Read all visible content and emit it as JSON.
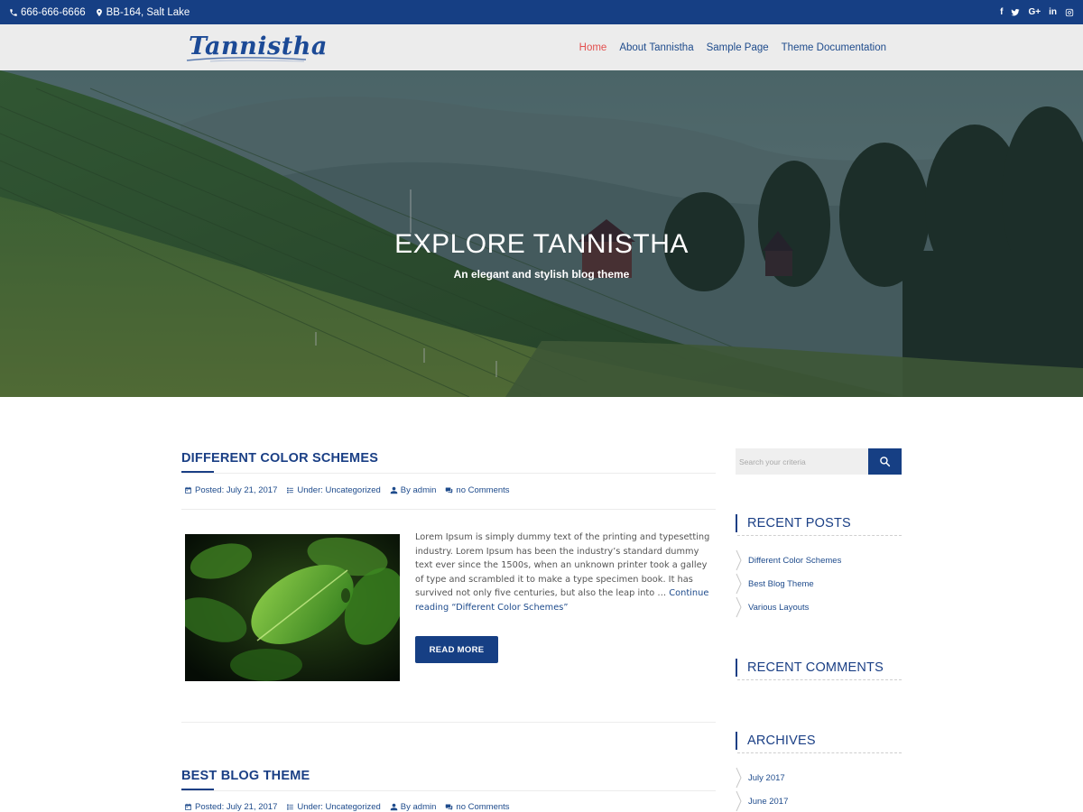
{
  "topbar": {
    "phone": "666-666-6666",
    "address": "BB-164, Salt Lake",
    "social": [
      "facebook-icon",
      "twitter-icon",
      "google-plus-icon",
      "linkedin-icon",
      "instagram-icon"
    ],
    "social_labels": {
      "facebook": "f",
      "twitter": "t",
      "google_plus": "G+",
      "linkedin": "in"
    }
  },
  "header": {
    "logo_text": "Tannistha",
    "nav": [
      "Home",
      "About Tannistha",
      "Sample Page",
      "Theme Documentation"
    ],
    "active_nav": "Home"
  },
  "hero": {
    "title": "EXPLORE TANNISTHA",
    "subtitle": "An elegant and stylish blog theme"
  },
  "posts": [
    {
      "title": "DIFFERENT COLOR SCHEMES",
      "posted": "Posted: July 21, 2017",
      "under": "Under: Uncategorized",
      "by": "By admin",
      "comments": "no Comments",
      "excerpt": "Lorem Ipsum is simply dummy text of the printing and typesetting industry. Lorem Ipsum has been the industry’s standard dummy text ever since the 1500s, when an unknown printer took a galley of type and scrambled it to make a type specimen book. It has survived not only five centuries, but also the leap into … ",
      "continue": "Continue reading “Different Color Schemes”",
      "read_more": "READ MORE"
    },
    {
      "title": "BEST BLOG THEME",
      "posted": "Posted: July 21, 2017",
      "under": "Under: Uncategorized",
      "by": "By admin",
      "comments": "no Comments"
    }
  ],
  "sidebar": {
    "search_placeholder": "Search your criteria",
    "recent_posts_title": "RECENT POSTS",
    "recent_posts": [
      "Different Color Schemes",
      "Best Blog Theme",
      "Various Layouts"
    ],
    "recent_comments_title": "RECENT COMMENTS",
    "archives_title": "ARCHIVES",
    "archives": [
      "July 2017",
      "June 2017"
    ]
  },
  "colors": {
    "primary": "#163f84",
    "nav_active": "#e3504f",
    "link": "#1e4b8c",
    "header_bg": "#ececec"
  }
}
